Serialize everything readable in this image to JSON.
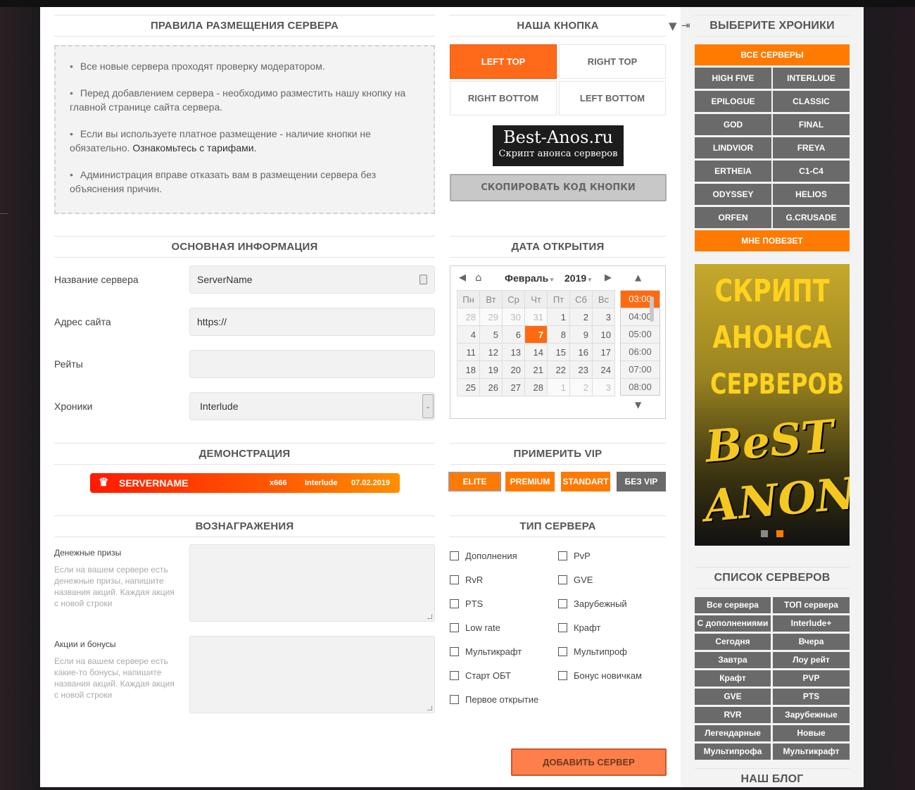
{
  "colors": {
    "accent": "#ff7a00",
    "dark_button": "#6a6a6a"
  },
  "rules": {
    "title": "ПРАВИЛА РАЗМЕЩЕНИЯ СЕРВЕРА",
    "items": [
      "Все новые сервера проходят проверку модератором.",
      "Перед добавлением сервера - необходимо разместить нашу кнопку на главной странице сайта сервера.",
      "Если вы используете платное размещение - наличие кнопки не обязательно. ",
      "Администрация вправе отказать вам в размещении сервера без объяснения причин."
    ],
    "tariff_link": "Ознакомьтесь с тарифами."
  },
  "basic": {
    "title": "ОСНОВНАЯ ИНФОРМАЦИЯ",
    "fields": [
      {
        "label": "Название сервера",
        "value": "ServerName"
      },
      {
        "label": "Адрес сайта",
        "value": "https://"
      },
      {
        "label": "Рейты",
        "value": ""
      },
      {
        "label": "Хроники",
        "value": "Interlude"
      }
    ]
  },
  "demo": {
    "title": "ДЕМОНСТРАЦИЯ",
    "name": "SERVERNAME",
    "rate": "x666",
    "chronicle": "Interlude",
    "date": "07.02.2019"
  },
  "rewards": {
    "title": "ВОЗНАГРАЖЕНИЯ",
    "money_label": "Денежные призы",
    "money_hint": "Если на вашем сервере есть денежные призы, напишите названия акций. Каждая акция с новой строки",
    "bonus_label": "Акции и бонусы",
    "bonus_hint": "Если на вашем сервере есть какие-то бонусы, напишите названия акций. Каждая акция с новой строки"
  },
  "button": {
    "title": "НАША КНОПКА",
    "positions": [
      "LEFT TOP",
      "RIGHT TOP",
      "RIGHT BOTTOM",
      "LEFT BOTTOM"
    ],
    "selected": "LEFT TOP",
    "logo_line1": "Best-Anos.ru",
    "logo_line2": "Скрипт анонса серверов",
    "copy": "СКОПИРОВАТЬ КОД КНОПКИ"
  },
  "date": {
    "title": "ДАТА ОТКРЫТИЯ",
    "month": "Февраль",
    "year": "2019",
    "weekdays": [
      "Пн",
      "Вт",
      "Ср",
      "Чт",
      "Пт",
      "Сб",
      "Вс"
    ],
    "days": [
      [
        "28",
        "29",
        "30",
        "31",
        "1",
        "2",
        "3"
      ],
      [
        "4",
        "5",
        "6",
        "7",
        "8",
        "9",
        "10"
      ],
      [
        "11",
        "12",
        "13",
        "14",
        "15",
        "16",
        "17"
      ],
      [
        "18",
        "19",
        "20",
        "21",
        "22",
        "23",
        "24"
      ],
      [
        "25",
        "26",
        "27",
        "28",
        "1",
        "2",
        "3"
      ]
    ],
    "selected_day": "7",
    "times": [
      "03:00",
      "04:00",
      "05:00",
      "06:00",
      "07:00",
      "08:00"
    ],
    "selected_time": "03:00"
  },
  "vip": {
    "title": "ПРИМЕРИТЬ VIP",
    "options": [
      "ELITE",
      "PREMIUM",
      "STANDART",
      "БЕЗ VIP"
    ],
    "selected": "ELITE"
  },
  "type": {
    "title": "ТИП СЕРВЕРА",
    "col1": [
      "Дополнения",
      "RvR",
      "PTS",
      "Low rate",
      "Мультикрафт",
      "Старт ОБТ",
      "Первое открытие"
    ],
    "col2": [
      "PvP",
      "GVE",
      "Зарубежный",
      "Крафт",
      "Мультипроф",
      "Бонус новичкам"
    ]
  },
  "submit": "ДОБАВИТЬ СЕРВЕР",
  "sidebar": {
    "chron_title": "ВЫБЕРИТЕ ХРОНИКИ",
    "all": "ВСЕ СЕРВЕРЫ",
    "chronicles": [
      "HIGH FIVE",
      "INTERLUDE",
      "EPILOGUE",
      "CLASSIC",
      "GOD",
      "FINAL",
      "LINDVIOR",
      "FREYA",
      "ERTHEIA",
      "C1-C4",
      "ODYSSEY",
      "HELIOS",
      "ORFEN",
      "G.CRUSADE"
    ],
    "lucky": "МНЕ ПОВЕЗЕТ",
    "banner": {
      "line1": "СКРИПТ",
      "line2": "АНОНСА",
      "line3": "СЕРВЕРОВ",
      "logo": "BeST ANONS"
    },
    "list_title": "СПИСОК СЕРВЕРОВ",
    "list": [
      "Все сервера",
      "ТОП сервера",
      "С дополнениями",
      "Interlude+",
      "Сегодня",
      "Вчера",
      "Завтра",
      "Лоу рейт",
      "Крафт",
      "PVP",
      "GVE",
      "PTS",
      "RVR",
      "Зарубежные",
      "Легендарные",
      "Новые",
      "Мультипрофа",
      "Мультикрафт"
    ],
    "blog_title": "НАШ БЛОГ"
  }
}
